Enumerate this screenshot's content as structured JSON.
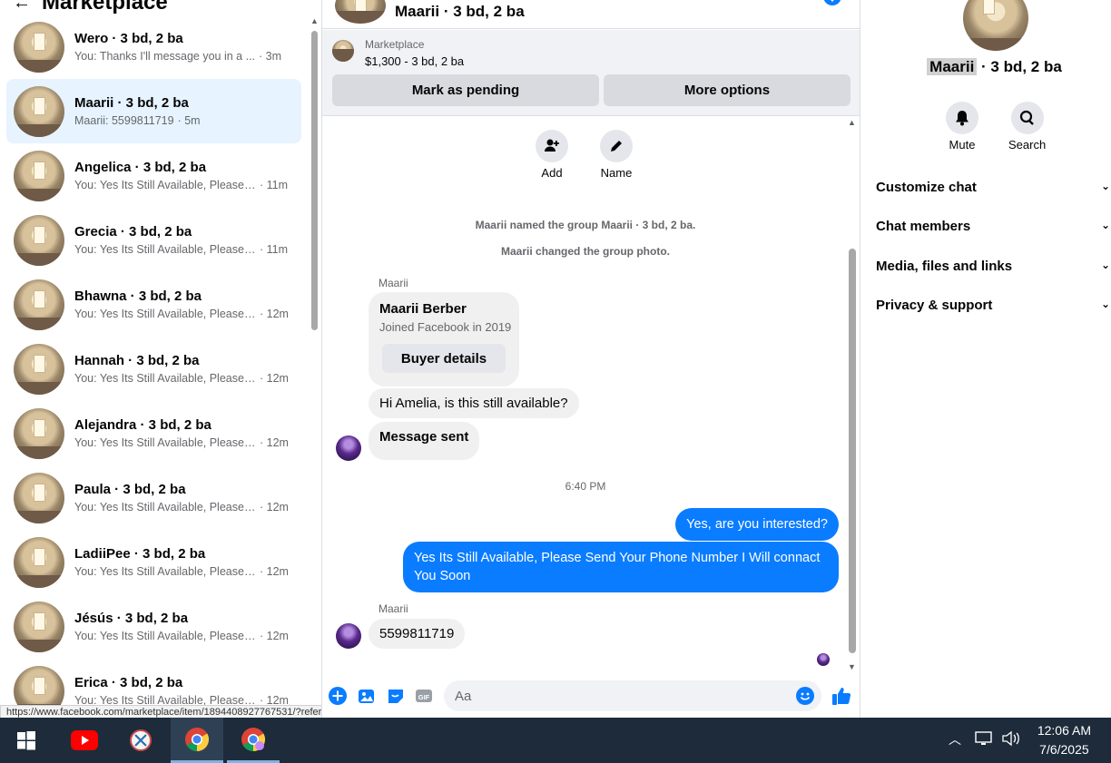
{
  "sidebar": {
    "title": "Marketplace",
    "conversations": [
      {
        "name": "Wero · 3 bd, 2 ba",
        "preview": "You: Thanks I'll message you in a ...",
        "time": "· 3m"
      },
      {
        "name": "Maarii · 3 bd, 2 ba",
        "preview": "Maarii: 5599811719",
        "time": "· 5m",
        "active": true
      },
      {
        "name": "Angelica · 3 bd, 2 ba",
        "preview": "You: Yes Its Still Available, Please ...",
        "time": "· 11m"
      },
      {
        "name": "Grecia · 3 bd, 2 ba",
        "preview": "You: Yes Its Still Available, Please ...",
        "time": "· 11m"
      },
      {
        "name": "Bhawna · 3 bd, 2 ba",
        "preview": "You: Yes Its Still Available, Please ...",
        "time": "· 12m"
      },
      {
        "name": "Hannah · 3 bd, 2 ba",
        "preview": "You: Yes Its Still Available, Please ...",
        "time": "· 12m"
      },
      {
        "name": "Alejandra · 3 bd, 2 ba",
        "preview": "You: Yes Its Still Available, Please ...",
        "time": "· 12m"
      },
      {
        "name": "Paula · 3 bd, 2 ba",
        "preview": "You: Yes Its Still Available, Please ...",
        "time": "· 12m"
      },
      {
        "name": "LadiiPee · 3 bd, 2 ba",
        "preview": "You: Yes Its Still Available, Please ...",
        "time": "· 12m"
      },
      {
        "name": "Jésús · 3 bd, 2 ba",
        "preview": "You: Yes Its Still Available, Please ...",
        "time": "· 12m"
      },
      {
        "name": "Erica · 3 bd, 2 ba",
        "preview": "You: Yes Its Still Available, Please ...",
        "time": "· 12m"
      }
    ],
    "status_url": "https://www.facebook.com/marketplace/item/1894408927767531/?referralS..."
  },
  "chat": {
    "header_name": "Maarii · 3 bd, 2 ba",
    "market_label": "Marketplace",
    "market_price": "$1,300 - 3 bd, 2 ba",
    "mark_pending": "Mark as pending",
    "more_options": "More options",
    "actions": {
      "add": "Add",
      "name": "Name"
    },
    "sys_named": "Maarii named the group Maarii · 3 bd, 2 ba.",
    "sys_photo": "Maarii changed the group photo.",
    "sender1": "Maarii",
    "card_name": "Maarii Berber",
    "card_joined": "Joined Facebook in 2019",
    "card_button": "Buyer details",
    "msg_available": "Hi Amelia, is this still available?",
    "msg_sent": "Message sent",
    "time_sep": "6:40 PM",
    "out1": "Yes, are you interested?",
    "out2": "Yes Its Still Available, Please Send Your Phone Number I Will connact You Soon",
    "sender2": "Maarii",
    "msg_phone": "5599811719",
    "composer_placeholder": "Aa"
  },
  "panel": {
    "title_highlight": "Maarii",
    "title_rest": " · 3 bd, 2 ba",
    "mute": "Mute",
    "search": "Search",
    "sections": [
      "Customize chat",
      "Chat members",
      "Media, files and links",
      "Privacy & support"
    ]
  },
  "taskbar": {
    "time": "12:06 AM",
    "date": "7/6/2025"
  },
  "colors": {
    "accent": "#0a7cff",
    "active_row": "#e7f3ff",
    "taskbar": "#1d2b3a"
  }
}
